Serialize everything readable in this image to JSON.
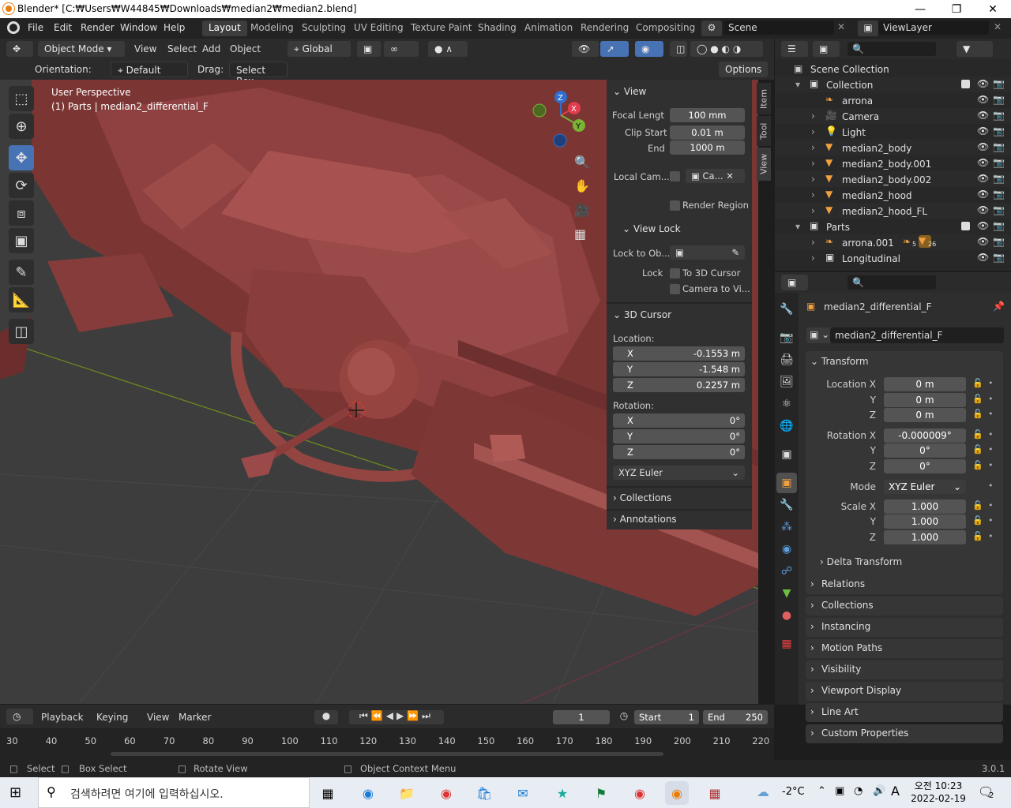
{
  "window": {
    "title": "Blender* [C:₩Users₩W44845₩Downloads₩median2₩median2.blend]"
  },
  "menus": [
    "File",
    "Edit",
    "Render",
    "Window",
    "Help"
  ],
  "workspaces": [
    {
      "label": "Layout",
      "active": true
    },
    {
      "label": "Modeling"
    },
    {
      "label": "Sculpting"
    },
    {
      "label": "UV Editing"
    },
    {
      "label": "Texture Paint"
    },
    {
      "label": "Shading"
    },
    {
      "label": "Animation"
    },
    {
      "label": "Rendering"
    },
    {
      "label": "Compositing"
    }
  ],
  "scene": {
    "name": "Scene",
    "view_layer": "ViewLayer"
  },
  "viewport_header": {
    "mode": "Object Mode",
    "menus": [
      "View",
      "Select",
      "Add",
      "Object"
    ],
    "transform": "Global"
  },
  "tool_settings": {
    "orientation_label": "Orientation:",
    "orientation": "Default",
    "drag_label": "Drag:",
    "drag": "Select Box",
    "options": "Options"
  },
  "viewport": {
    "perspective": "User Perspective",
    "object_info": "(1) Parts | median2_differential_F",
    "gizmo_axes": {
      "x": "X",
      "y": "Y",
      "z": "Z"
    },
    "colors": {
      "x": "#e23c4e",
      "y": "#7ab434",
      "z": "#2f6fd0",
      "model": "#8e4140",
      "floor": "#3d3d3d"
    }
  },
  "side_tabs": [
    "Item",
    "Tool",
    "View"
  ],
  "npanel": {
    "view_header": "View",
    "focal_label": "Focal Lengt",
    "focal_value": "100 mm",
    "clip_start_label": "Clip Start",
    "clip_start_value": "0.01 m",
    "end_label": "End",
    "end_value": "1000 m",
    "local_cam_label": "Local Cam...",
    "local_cam_value": "Ca...",
    "render_region": "Render Region",
    "view_lock_header": "View Lock",
    "lock_to_label": "Lock to Ob...",
    "lock_label": "Lock",
    "to_3d_cursor": "To 3D Cursor",
    "camera_to_view": "Camera to Vi...",
    "cursor_header": "3D Cursor",
    "location_label": "Location:",
    "loc": [
      {
        "axis": "X",
        "value": "-0.1553 m"
      },
      {
        "axis": "Y",
        "value": "-1.548 m"
      },
      {
        "axis": "Z",
        "value": "0.2257 m"
      }
    ],
    "rotation_label": "Rotation:",
    "rot": [
      {
        "axis": "X",
        "value": "0°"
      },
      {
        "axis": "Y",
        "value": "0°"
      },
      {
        "axis": "Z",
        "value": "0°"
      }
    ],
    "rot_mode": "XYZ Euler",
    "collections": "Collections",
    "annotations": "Annotations"
  },
  "outliner": {
    "root": "Scene Collection",
    "rows": [
      {
        "label": "Collection",
        "indent": 1,
        "type": "collection"
      },
      {
        "label": "arrona",
        "indent": 2,
        "type": "armature"
      },
      {
        "label": "Camera",
        "indent": 2,
        "type": "camera"
      },
      {
        "label": "Light",
        "indent": 2,
        "type": "light"
      },
      {
        "label": "median2_body",
        "indent": 2,
        "type": "mesh"
      },
      {
        "label": "median2_body.001",
        "indent": 2,
        "type": "mesh"
      },
      {
        "label": "median2_body.002",
        "indent": 2,
        "type": "mesh"
      },
      {
        "label": "median2_hood",
        "indent": 2,
        "type": "mesh"
      },
      {
        "label": "median2_hood_FL",
        "indent": 2,
        "type": "mesh"
      },
      {
        "label": "Parts",
        "indent": 1,
        "type": "collection"
      },
      {
        "label": "arrona.001",
        "indent": 2,
        "type": "armature"
      },
      {
        "label": "Longitudinal",
        "indent": 2,
        "type": "empty"
      }
    ],
    "badges": {
      "arrona001_a": "5",
      "arrona001_b": "26"
    }
  },
  "properties": {
    "object_name": "median2_differential_F",
    "data_name": "median2_differential_F",
    "transform_header": "Transform",
    "location_label": "Location X",
    "location": [
      "0 m",
      "0 m",
      "0 m"
    ],
    "rotation_label": "Rotation X",
    "rotation": [
      "-0.000009°",
      "0°",
      "0°"
    ],
    "mode_label": "Mode",
    "mode": "XYZ Euler",
    "scale_label": "Scale X",
    "scale": [
      "1.000",
      "1.000",
      "1.000"
    ],
    "axis_y": "Y",
    "axis_z": "Z",
    "delta": "Delta Transform",
    "sections": [
      "Relations",
      "Collections",
      "Instancing",
      "Motion Paths",
      "Visibility",
      "Viewport Display",
      "Line Art",
      "Custom Properties"
    ]
  },
  "timeline": {
    "menus": [
      "Playback",
      "Keying",
      "View",
      "Marker"
    ],
    "current_frame": "1",
    "start_label": "Start",
    "start": "1",
    "end_label": "End",
    "end": "250",
    "ticks": [
      "30",
      "40",
      "50",
      "60",
      "70",
      "80",
      "90",
      "100",
      "110",
      "120",
      "130",
      "140",
      "150",
      "160",
      "170",
      "180",
      "190",
      "200",
      "210",
      "220"
    ]
  },
  "statusbar": {
    "select": "Select",
    "box_select": "Box Select",
    "rotate_view": "Rotate View",
    "context_menu": "Object Context Menu",
    "version": "3.0.1"
  },
  "taskbar": {
    "search_placeholder": "검색하려면 여기에 입력하십시오.",
    "weather": "-2°C",
    "ime": "A",
    "time": "오전 10:23",
    "date": "2022-02-19",
    "notif_count": "2"
  }
}
